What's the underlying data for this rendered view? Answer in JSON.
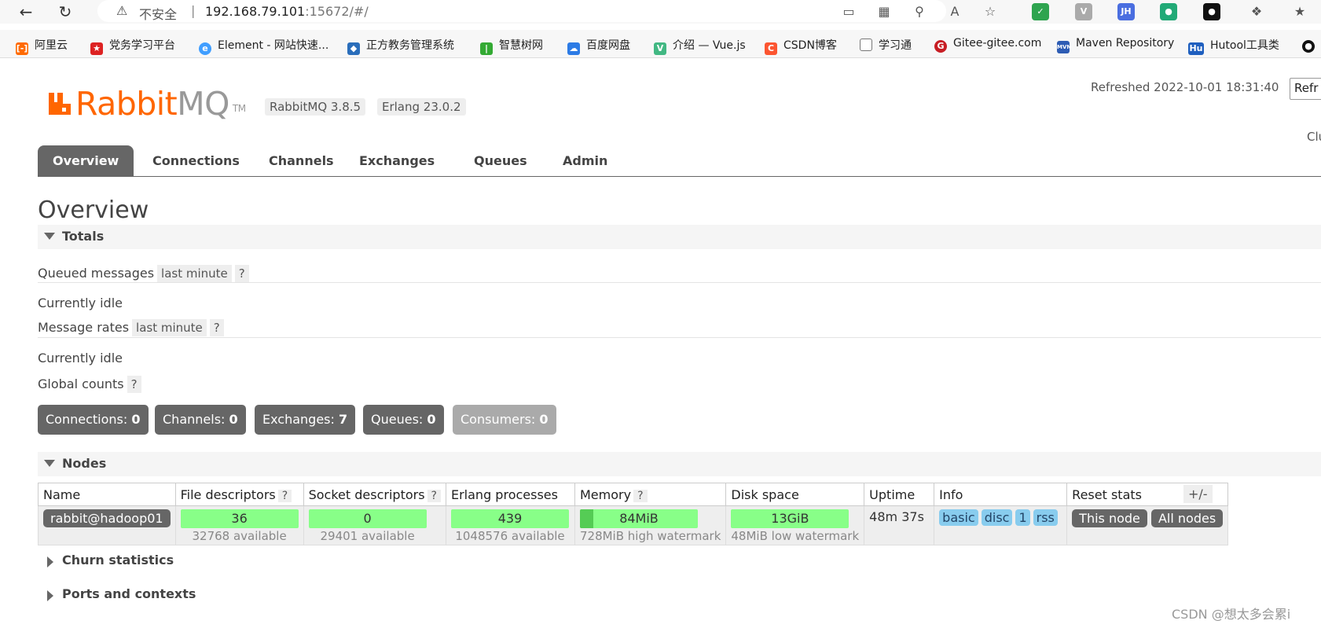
{
  "browser": {
    "insecure_label": "不安全",
    "separator": "|",
    "url_host": "192.168.79.101",
    "url_path": ":15672/#/"
  },
  "bookmarks": [
    {
      "label": "阿里云",
      "icon": "aliyun-icon",
      "color": "#ff6a00"
    },
    {
      "label": "党务学习平台",
      "icon": "party-icon",
      "color": "#d22"
    },
    {
      "label": "Element - 网站快速...",
      "icon": "element-icon",
      "color": "#409eff"
    },
    {
      "label": "正方教务管理系统",
      "icon": "zf-icon",
      "color": "#2a6ebb"
    },
    {
      "label": "智慧树网",
      "icon": "zhs-icon",
      "color": "#3a3"
    },
    {
      "label": "百度网盘",
      "icon": "baidu-pan-icon",
      "color": "#2c7be5"
    },
    {
      "label": "介绍 — Vue.js",
      "icon": "vue-icon",
      "color": "#42b883"
    },
    {
      "label": "CSDN博客",
      "icon": "csdn-icon",
      "color": "#fc5531"
    },
    {
      "label": "学习通",
      "icon": "document-icon",
      "color": "#777"
    },
    {
      "label": "Gitee-gitee.com",
      "icon": "gitee-icon",
      "color": "#c71d23"
    },
    {
      "label": "Maven Repository",
      "icon": "mvn-icon",
      "color": "#2d5cb4"
    },
    {
      "label": "Hutool工具类",
      "icon": "hutool-icon",
      "color": "#1f5fbf"
    }
  ],
  "header": {
    "logo_rabbit": "Rabbit",
    "logo_mq": "MQ",
    "logo_tm": "TM",
    "rabbitmq_version": "RabbitMQ 3.8.5",
    "erlang_version": "Erlang 23.0.2",
    "refreshed": "Refreshed 2022-10-01 18:31:40",
    "refresh_select": "Refr",
    "cluster": "Clu"
  },
  "tabs": [
    {
      "label": "Overview",
      "active": true
    },
    {
      "label": "Connections"
    },
    {
      "label": "Channels"
    },
    {
      "label": "Exchanges"
    },
    {
      "label": "Queues"
    },
    {
      "label": "Admin"
    }
  ],
  "page_title": "Overview",
  "totals": {
    "header": "Totals",
    "queued_messages": "Queued messages",
    "message_rates": "Message rates",
    "last_minute": "last minute",
    "help": "?",
    "idle": "Currently idle",
    "global_counts": "Global counts"
  },
  "counts": [
    {
      "label": "Connections:",
      "value": "0"
    },
    {
      "label": "Channels:",
      "value": "0"
    },
    {
      "label": "Exchanges:",
      "value": "7"
    },
    {
      "label": "Queues:",
      "value": "0"
    },
    {
      "label": "Consumers:",
      "value": "0"
    }
  ],
  "nodes": {
    "header": "Nodes",
    "columns": [
      "Name",
      "File descriptors",
      "Socket descriptors",
      "Erlang processes",
      "Memory",
      "Disk space",
      "Uptime",
      "Info",
      "Reset stats"
    ],
    "plus_minus": "+/-",
    "row": {
      "name": "rabbit@hadoop01",
      "fd_value": "36",
      "fd_available": "32768 available",
      "sockets_value": "0",
      "sockets_available": "29401 available",
      "procs_value": "439",
      "procs_available": "1048576 available",
      "memory_value": "84MiB",
      "memory_watermark": "728MiB high watermark",
      "memory_fill": 0.115,
      "disk_value": "13GiB",
      "disk_watermark": "48MiB low watermark",
      "uptime": "48m 37s",
      "info_tags": [
        "basic",
        "disc",
        "1",
        "rss"
      ],
      "reset_this": "This node",
      "reset_all": "All nodes"
    }
  },
  "collapsed_sections": [
    "Churn statistics",
    "Ports and contexts"
  ],
  "watermark": "CSDN @想太多会累i"
}
